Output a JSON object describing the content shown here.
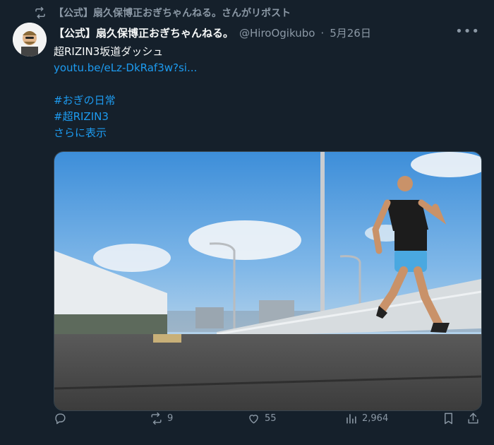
{
  "repost_banner": {
    "text": "【公式】扇久保博正おぎちゃんねる。さんがリポスト"
  },
  "author": {
    "display_name": "【公式】扇久保博正おぎちゃんねる。",
    "handle": "@HiroOgikubo",
    "separator": "·",
    "date": "5月26日"
  },
  "tweet": {
    "title": "超RIZIN3坂道ダッシュ",
    "link": "youtu.be/eLz-DkRaf3w?si...",
    "hashtags": [
      "#おぎの日常",
      "#超RIZIN3"
    ],
    "show_more": "さらに表示"
  },
  "actions": {
    "replies": "",
    "reposts": "9",
    "likes": "55",
    "views": "2,964"
  },
  "colors": {
    "background": "#15202b",
    "link": "#1d9bf0",
    "muted": "#8b98a5"
  }
}
